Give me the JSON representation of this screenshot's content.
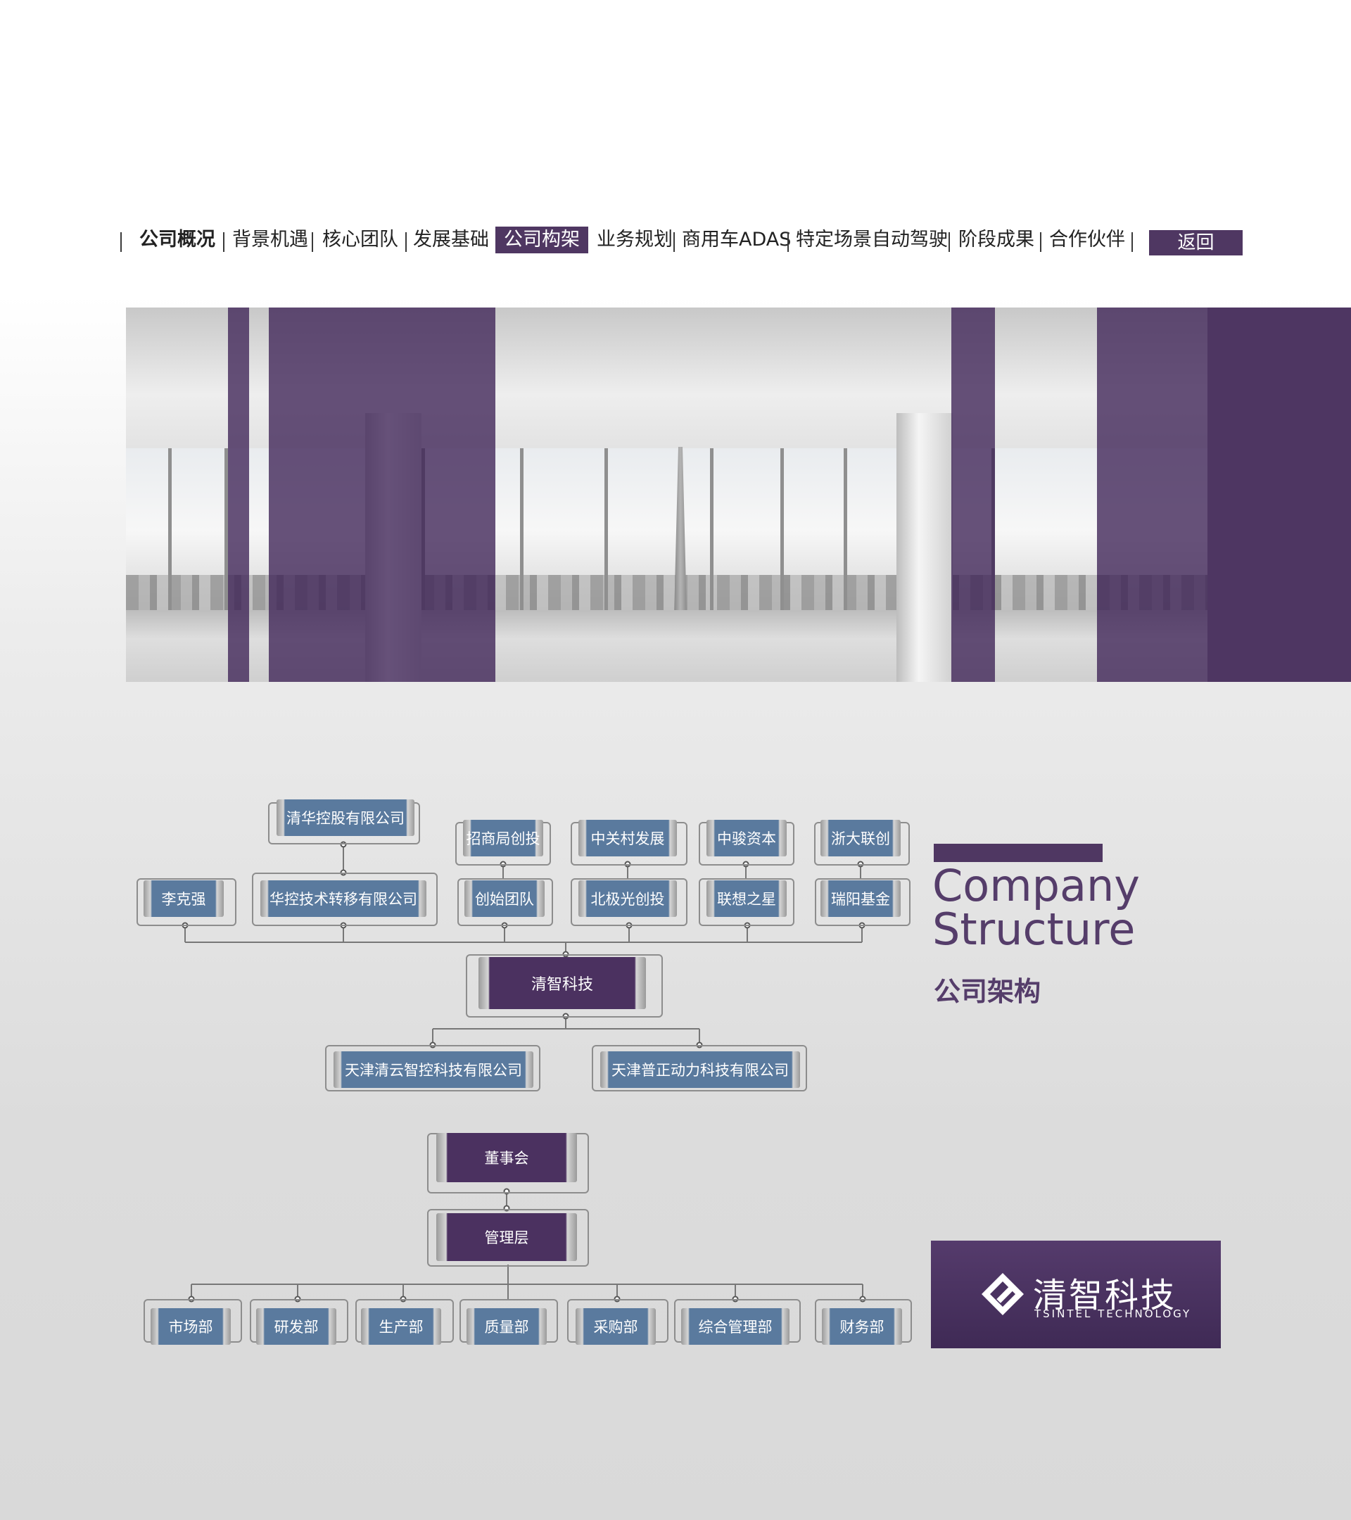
{
  "nav": {
    "items": [
      "公司概况",
      "背景机遇",
      "核心团队",
      "发展基础",
      "公司构架",
      "业务规划",
      "商用车ADAS",
      "特定场景自动驾驶",
      "阶段成果",
      "合作伙伴"
    ],
    "active": "公司构架",
    "back_label": "返回"
  },
  "colors": {
    "brand_purple": "#4f3762",
    "node_blue": "#5a7a9e",
    "node_purple": "#4b3160"
  },
  "title": {
    "en_line1": "Company",
    "en_line2": "Structure",
    "cn": "公司架构"
  },
  "shareholders": {
    "top_row": [
      "清华控股有限公司",
      "招商局创投",
      "中关村发展",
      "中骏资本",
      "浙大联创"
    ],
    "second_row": [
      "李克强",
      "华控技术转移有限公司",
      "创始团队",
      "北极光创投",
      "联想之星",
      "瑞阳基金"
    ]
  },
  "company": "清智科技",
  "subsidiaries": [
    "天津清云智控科技有限公司",
    "天津普正动力科技有限公司"
  ],
  "org": {
    "board": "董事会",
    "management": "管理层",
    "departments": [
      "市场部",
      "研发部",
      "生产部",
      "质量部",
      "采购部",
      "综合管理部",
      "财务部"
    ]
  },
  "logo": {
    "cn": "清智科技",
    "en": "TSINTEL TECHNOLOGY"
  }
}
